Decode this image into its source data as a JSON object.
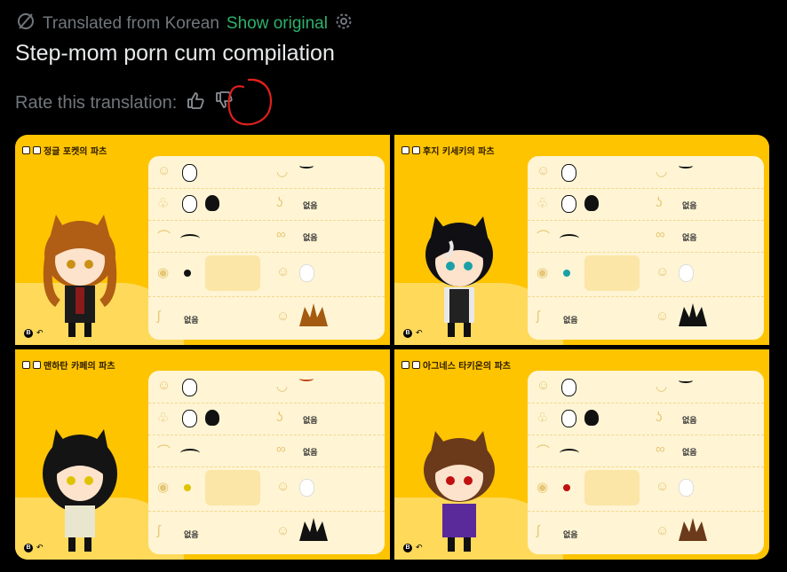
{
  "translation": {
    "from_label": "Translated from Korean",
    "show_original": "Show original"
  },
  "post": {
    "title": "Step-mom porn cum compilation"
  },
  "rate": {
    "label": "Rate this translation:"
  },
  "annotation_color": "#e0201c",
  "panels": [
    {
      "title": "정글 포켓의 파츠",
      "none": "없음",
      "hair_color": "#b05d16",
      "eye_color": "#c99214",
      "acc_color": "#a45a10"
    },
    {
      "title": "후지 키세키의 파츠",
      "none": "없음",
      "hair_color": "#101014",
      "eye_color": "#1aa0a6",
      "acc_color": "#111"
    },
    {
      "title": "맨하탄 카페의 파츠",
      "none": "없음",
      "hair_color": "#141414",
      "eye_color": "#e0c300",
      "acc_color": "#111"
    },
    {
      "title": "아그네스 타키온의 파츠",
      "none": "없음",
      "hair_color": "#6b3a1a",
      "eye_color": "#c01010",
      "acc_color": "#6b3a1a"
    }
  ],
  "icons": {
    "translate": "translate-icon",
    "settings": "gear-icon",
    "thumbs_up": "thumbs-up-icon",
    "thumbs_down": "thumbs-down-icon"
  }
}
